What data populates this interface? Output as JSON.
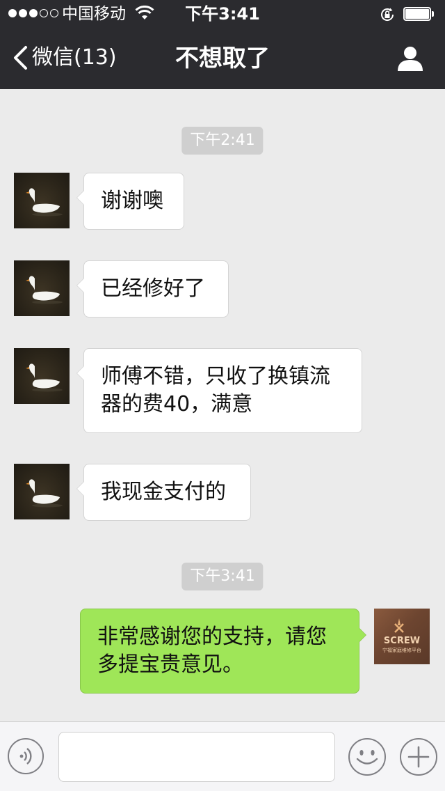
{
  "status_bar": {
    "carrier": "中国移动",
    "time": "下午3:41",
    "signal_bars_filled": 3,
    "signal_bars_total": 5
  },
  "nav": {
    "back_label": "微信(13)",
    "title": "不想取了"
  },
  "chat": {
    "timestamps": [
      "下午2:41",
      "下午3:41"
    ],
    "messages": [
      {
        "from": "other",
        "text": "谢谢噢"
      },
      {
        "from": "other",
        "text": "已经修好了"
      },
      {
        "from": "other",
        "text": "师傅不错，只收了换镇流器的费40，满意"
      },
      {
        "from": "other",
        "text": "我现金支付的"
      },
      {
        "from": "me",
        "text": "非常感谢您的支持，请您多提宝贵意见。"
      }
    ],
    "my_avatar_text": "SCREW",
    "my_avatar_subtext": "宁福家庭维修平台"
  },
  "input_bar": {
    "placeholder": ""
  },
  "colors": {
    "header_bg": "#2b2b2f",
    "chat_bg": "#ebebeb",
    "outgoing_bubble": "#9fe658",
    "incoming_bubble": "#ffffff",
    "timestamp_bg": "#cfcfcf"
  },
  "icons": [
    "wifi-icon",
    "rotation-lock-icon",
    "battery-icon",
    "back-chevron-icon",
    "profile-icon",
    "voice-icon",
    "emoji-icon",
    "add-icon"
  ]
}
